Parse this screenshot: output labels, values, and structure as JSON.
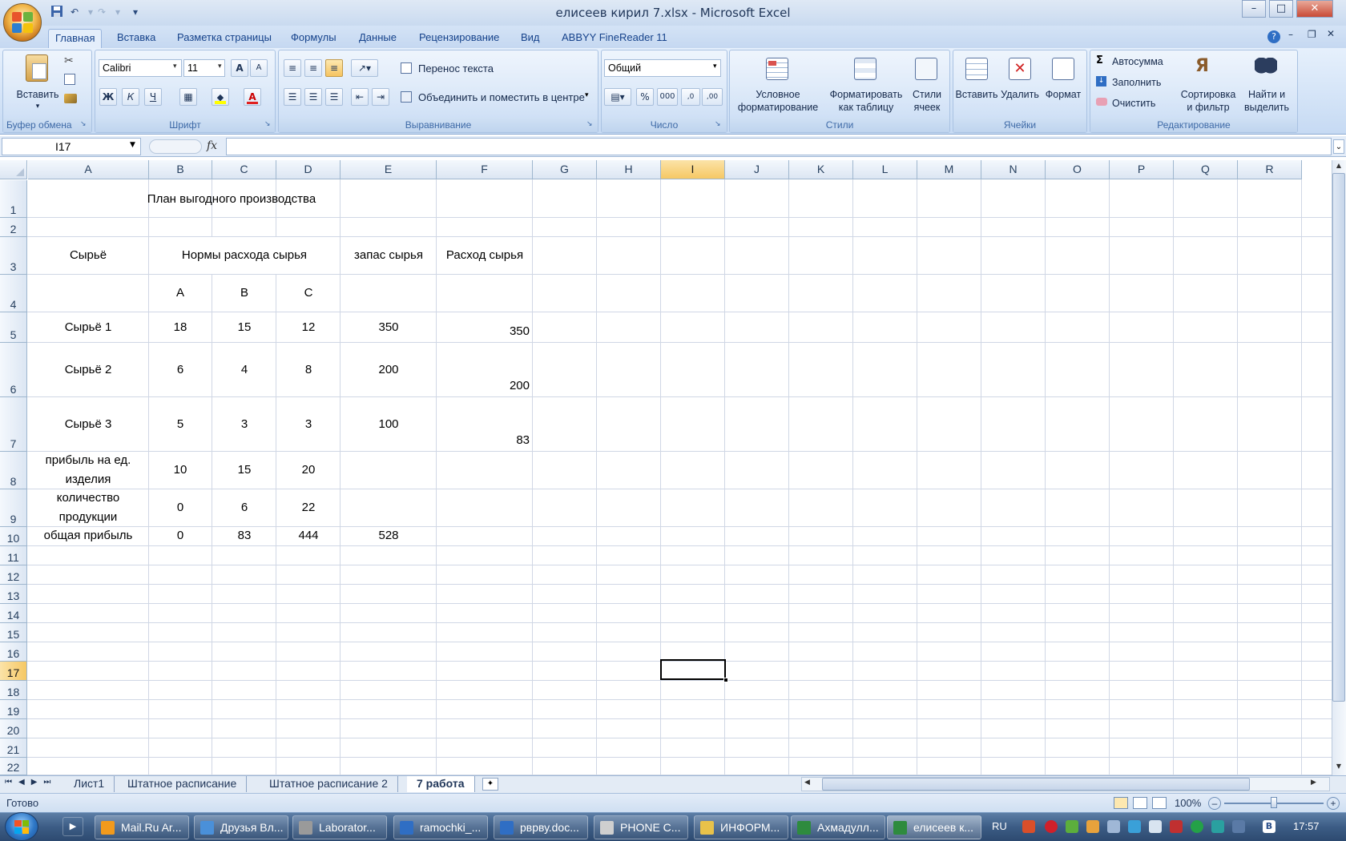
{
  "window": {
    "title": "елисеев кирил 7.xlsx - Microsoft Excel",
    "min": "–",
    "max": "□",
    "close": "✕"
  },
  "ribbon_tabs": [
    "Главная",
    "Вставка",
    "Разметка страницы",
    "Формулы",
    "Данные",
    "Рецензирование",
    "Вид",
    "ABBYY FineReader 11"
  ],
  "clipboard": {
    "label": "Буфер обмена",
    "paste": "Вставить"
  },
  "font": {
    "label": "Шрифт",
    "name": "Calibri",
    "size": "11",
    "bold": "Ж",
    "italic": "К",
    "underline": "Ч",
    "grow": "A",
    "shrink": "A",
    "font_color": "A"
  },
  "alignment": {
    "label": "Выравнивание",
    "wrap": "Перенос текста",
    "merge": "Объединить и поместить в центре"
  },
  "number": {
    "label": "Число",
    "format": "Общий",
    "percent": "%",
    "thousands": "000",
    "inc_dec": ",0",
    "dec_dec": ",00"
  },
  "styles": {
    "label": "Стили",
    "conditional": [
      "Условное",
      "форматирование"
    ],
    "as_table": [
      "Форматировать",
      "как таблицу"
    ],
    "cell_styles": [
      "Стили",
      "ячеек"
    ]
  },
  "cells_group": {
    "label": "Ячейки",
    "insert": "Вставить",
    "delete": "Удалить",
    "format": "Формат"
  },
  "editing": {
    "label": "Редактирование",
    "autosum": "Автосумма",
    "fill": "Заполнить",
    "clear": "Очистить",
    "sort": [
      "Сортировка",
      "и фильтр"
    ],
    "find": [
      "Найти и",
      "выделить"
    ]
  },
  "formula_bar": {
    "name_box": "I17",
    "fx": "fx",
    "value": ""
  },
  "columns": [
    "A",
    "B",
    "C",
    "D",
    "E",
    "F",
    "G",
    "H",
    "I",
    "J",
    "K",
    "L",
    "M",
    "N",
    "O",
    "P",
    "Q",
    "R"
  ],
  "selected_column": "I",
  "rows": [
    "1",
    "2",
    "3",
    "4",
    "5",
    "6",
    "7",
    "8",
    "9",
    "10",
    "11",
    "12",
    "13",
    "14",
    "15",
    "16",
    "17",
    "18",
    "19",
    "20",
    "21",
    "22"
  ],
  "selected_row": "17",
  "sheet": {
    "title": "План выгодного производства",
    "header_raw": "Сырьё",
    "header_norms": "Нормы расхода сырья",
    "header_stock": "запас сырья",
    "header_usage": "Расход сырья",
    "products": [
      "A",
      "B",
      "C"
    ],
    "rows": [
      {
        "name": "Сырьё 1",
        "a": "18",
        "b": "15",
        "c": "12",
        "stock": "350",
        "usage": "350"
      },
      {
        "name": "Сырьё 2",
        "a": "6",
        "b": "4",
        "c": "8",
        "stock": "200",
        "usage": "200"
      },
      {
        "name": "Сырьё 3",
        "a": "5",
        "b": "3",
        "c": "3",
        "stock": "100",
        "usage": "83"
      }
    ],
    "profit_label": [
      "прибыль на ед.",
      "изделия"
    ],
    "profit": [
      "10",
      "15",
      "20"
    ],
    "qty_label": [
      "количество",
      "продукции"
    ],
    "qty": [
      "0",
      "6",
      "22"
    ],
    "total_label": "общая прибыль",
    "total": [
      "0",
      "83",
      "444",
      "528"
    ]
  },
  "sheet_tabs": [
    "Лист1",
    "Штатное расписание",
    "Штатное расписание 2",
    "7 работа"
  ],
  "active_sheet": "7 работа",
  "status": {
    "ready": "Готово",
    "zoom": "100%"
  },
  "taskbar": {
    "items": [
      "Mail.Ru Ar...",
      "Друзья Вл...",
      "Laborator...",
      "ramochki_...",
      "рврву.doc...",
      "PHONE C...",
      "ИНФОРМ...",
      "Ахмадулл...",
      "елисеев к..."
    ],
    "lang": "RU",
    "clock": "17:57"
  }
}
